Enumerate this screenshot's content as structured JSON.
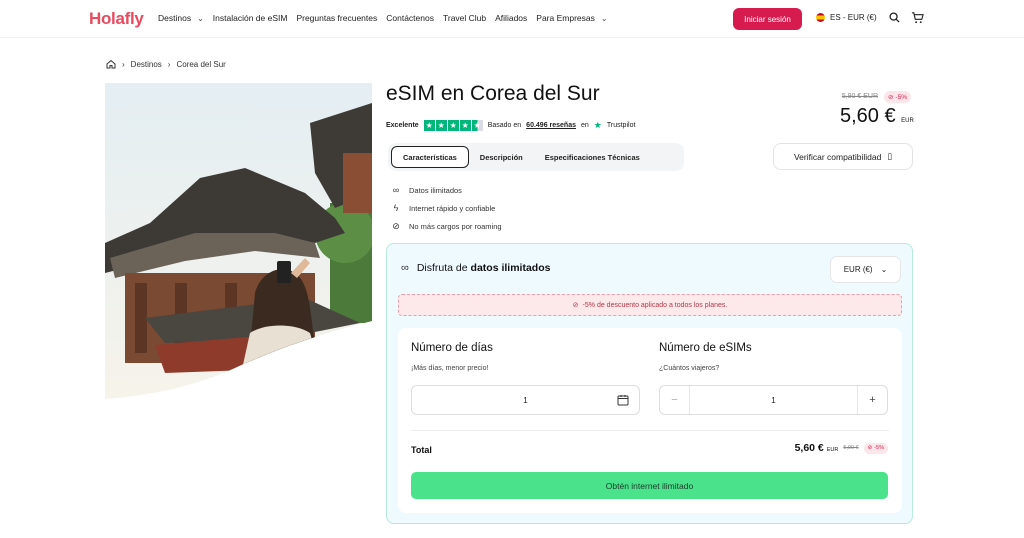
{
  "nav": {
    "logo": "Holafly",
    "links": [
      {
        "label": "Destinos",
        "dropdown": true
      },
      {
        "label": "Instalación de eSIM",
        "dropdown": false
      },
      {
        "label": "Preguntas frecuentes",
        "dropdown": false
      },
      {
        "label": "Contáctenos",
        "dropdown": false
      },
      {
        "label": "Travel Club",
        "dropdown": false
      },
      {
        "label": "Afiliados",
        "dropdown": false
      },
      {
        "label": "Para Empresas",
        "dropdown": true
      }
    ],
    "login_label": "Iniciar sesión",
    "lang_label": "ES - EUR (€)",
    "accent_color": "#d81b4f"
  },
  "breadcrumb": {
    "items": [
      "Destinos",
      "Corea del Sur"
    ]
  },
  "product": {
    "title": "eSIM en Corea del Sur",
    "rating_label": "Excelente",
    "rating_stars": 4.5,
    "reviews_prefix": "Basado en",
    "reviews_count": "60.496 reseñas",
    "reviews_suffix": "en",
    "trustpilot": "Trustpilot",
    "old_price": "5,90 € EUR",
    "discount": "-5%",
    "price": "5,60 €",
    "price_currency": "EUR"
  },
  "tabs": [
    {
      "label": "Características",
      "active": true
    },
    {
      "label": "Descripción",
      "active": false
    },
    {
      "label": "Especificaciones Técnicas",
      "active": false
    }
  ],
  "verify_label": "Verificar compatibilidad",
  "features": [
    {
      "icon": "infinity-icon",
      "label": "Datos ilimitados"
    },
    {
      "icon": "lightning-icon",
      "label": "Internet rápido y confiable"
    },
    {
      "icon": "no-roaming-icon",
      "label": "No más cargos por roaming"
    }
  ],
  "panel": {
    "title_prefix": "Disfruta de",
    "title_bold": "datos ilimitados",
    "currency": "EUR (€)",
    "discount_notice": "-5% de descuento aplicado a todos los planes.",
    "days_title": "Número de días",
    "days_sub": "¡Más días, menor precio!",
    "days_value": "1",
    "esims_title": "Número de eSIMs",
    "esims_sub": "¿Cuántos viajeros?",
    "esims_value": "1",
    "total_label": "Total",
    "total_price": "5,60 €",
    "total_currency": "EUR",
    "total_old": "5,90 €",
    "total_discount": "-5%",
    "cta_label": "Obtén internet ilimitado",
    "cta_color": "#4ae28a"
  }
}
